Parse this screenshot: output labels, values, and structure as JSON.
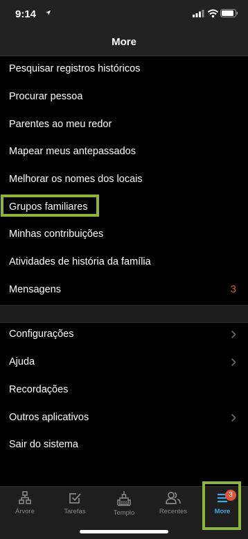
{
  "status_bar": {
    "time": "9:14"
  },
  "nav": {
    "title": "More"
  },
  "menu": {
    "items": [
      {
        "label": "Pesquisar registros históricos"
      },
      {
        "label": "Procurar pessoa"
      },
      {
        "label": "Parentes ao meu redor"
      },
      {
        "label": "Mapear meus antepassados"
      },
      {
        "label": "Melhorar os nomes dos locais"
      },
      {
        "label": "Grupos familiares",
        "highlighted": true
      },
      {
        "label": "Minhas contribuições"
      },
      {
        "label": "Atividades de história da família"
      },
      {
        "label": "Mensagens",
        "count": "3"
      }
    ],
    "settings_items": [
      {
        "label": "Configurações",
        "chevron": true
      },
      {
        "label": "Ajuda",
        "chevron": true
      },
      {
        "label": "Recordações"
      },
      {
        "label": "Outros aplicativos",
        "chevron": true
      },
      {
        "label": "Sair do sistema"
      }
    ]
  },
  "tab_bar": {
    "tabs": [
      {
        "label": "Árvore",
        "icon": "tree-icon"
      },
      {
        "label": "Tarefas",
        "icon": "tasks-icon"
      },
      {
        "label": "Templo",
        "icon": "temple-icon"
      },
      {
        "label": "Recentes",
        "icon": "people-icon"
      },
      {
        "label": "More",
        "icon": "menu-icon",
        "active": true,
        "badge": "3"
      }
    ]
  },
  "colors": {
    "background": "#000000",
    "bar_background": "#222222",
    "accent": "#3aa9e0",
    "badge": "#e0533d",
    "highlight_border": "#8db43a"
  }
}
